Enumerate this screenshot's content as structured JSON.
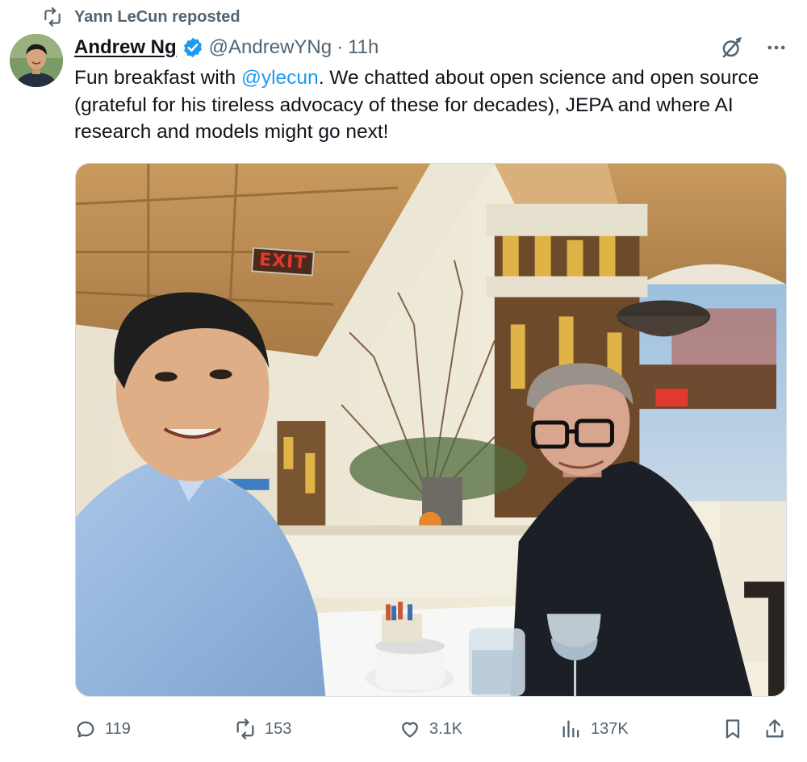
{
  "repost": {
    "label": "Yann LeCun reposted"
  },
  "author": {
    "name": "Andrew Ng",
    "handle": "@AndrewYNg",
    "separator": "·",
    "time": "11h"
  },
  "tweet": {
    "text_before": "Fun breakfast with ",
    "mention": "@ylecun",
    "text_after": ". We chatted about open science and open source (grateful for his tireless advocacy of these for decades), JEPA and where AI research and models might go next!"
  },
  "media": {
    "exit_sign": "EXIT"
  },
  "actions": {
    "replies": "119",
    "reposts": "153",
    "likes": "3.1K",
    "views": "137K"
  },
  "icons": {
    "repost": "repost-icon",
    "verified": "verified-badge-icon",
    "grok": "grok-icon",
    "more": "more-icon",
    "reply": "reply-icon",
    "like": "heart-icon",
    "views": "views-icon",
    "bookmark": "bookmark-icon",
    "share": "share-icon"
  },
  "colors": {
    "accent": "#1d9bf0",
    "muted": "#536471",
    "text": "#0f1419",
    "exit_red": "#e0392f"
  }
}
